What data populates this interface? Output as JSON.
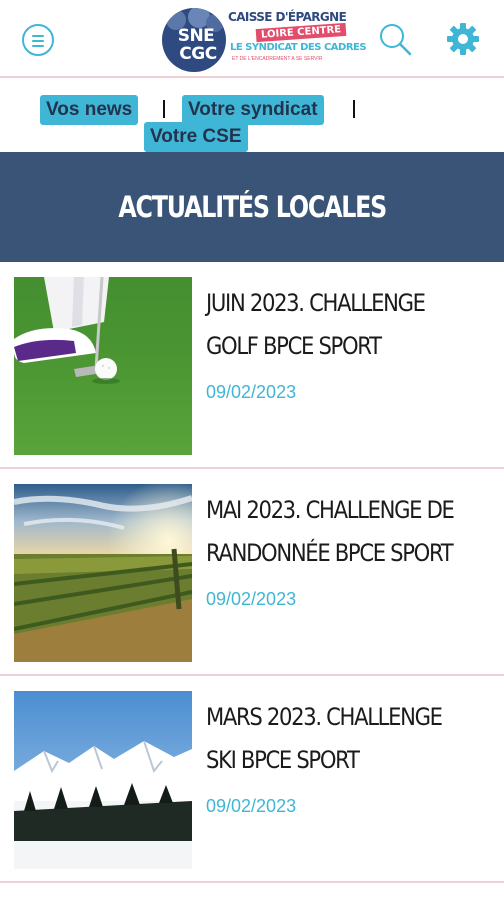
{
  "header": {
    "menu_icon": "hamburger-menu-icon",
    "logo": {
      "badge_line1": "SNE",
      "badge_line2": "CGC",
      "line1": "CAISSE D'ÉPARGNE",
      "line2": "LOIRE CENTRE",
      "line3": "LE SYNDICAT DES CADRES",
      "line4": "ET DE L'ENCADREMENT A SE SERVIR"
    },
    "search_icon": "search-icon",
    "settings_icon": "gear-icon"
  },
  "nav": {
    "items": [
      {
        "label": "Vos news"
      },
      {
        "label": "Votre syndicat"
      },
      {
        "label": "Votre CSE"
      }
    ]
  },
  "section": {
    "title": "ACTUALITÉS LOCALES"
  },
  "articles": [
    {
      "title": "JUIN 2023. CHALLENGE GOLF BPCE SPORT",
      "date": "09/02/2023",
      "image": "golf-photo"
    },
    {
      "title": "MAI 2023. CHALLENGE DE RANDONNÉE BPCE SPORT",
      "date": "09/02/2023",
      "image": "vineyard-sunset-photo"
    },
    {
      "title": "MARS 2023. CHALLENGE SKI BPCE SPORT",
      "date": "09/02/2023",
      "image": "snowy-mountains-photo"
    }
  ],
  "colors": {
    "accent": "#3fb6d6",
    "banner": "#3a5478",
    "divider": "#f1cdd6",
    "logo_navy": "#2e4a80",
    "logo_pink": "#e14d6b"
  }
}
